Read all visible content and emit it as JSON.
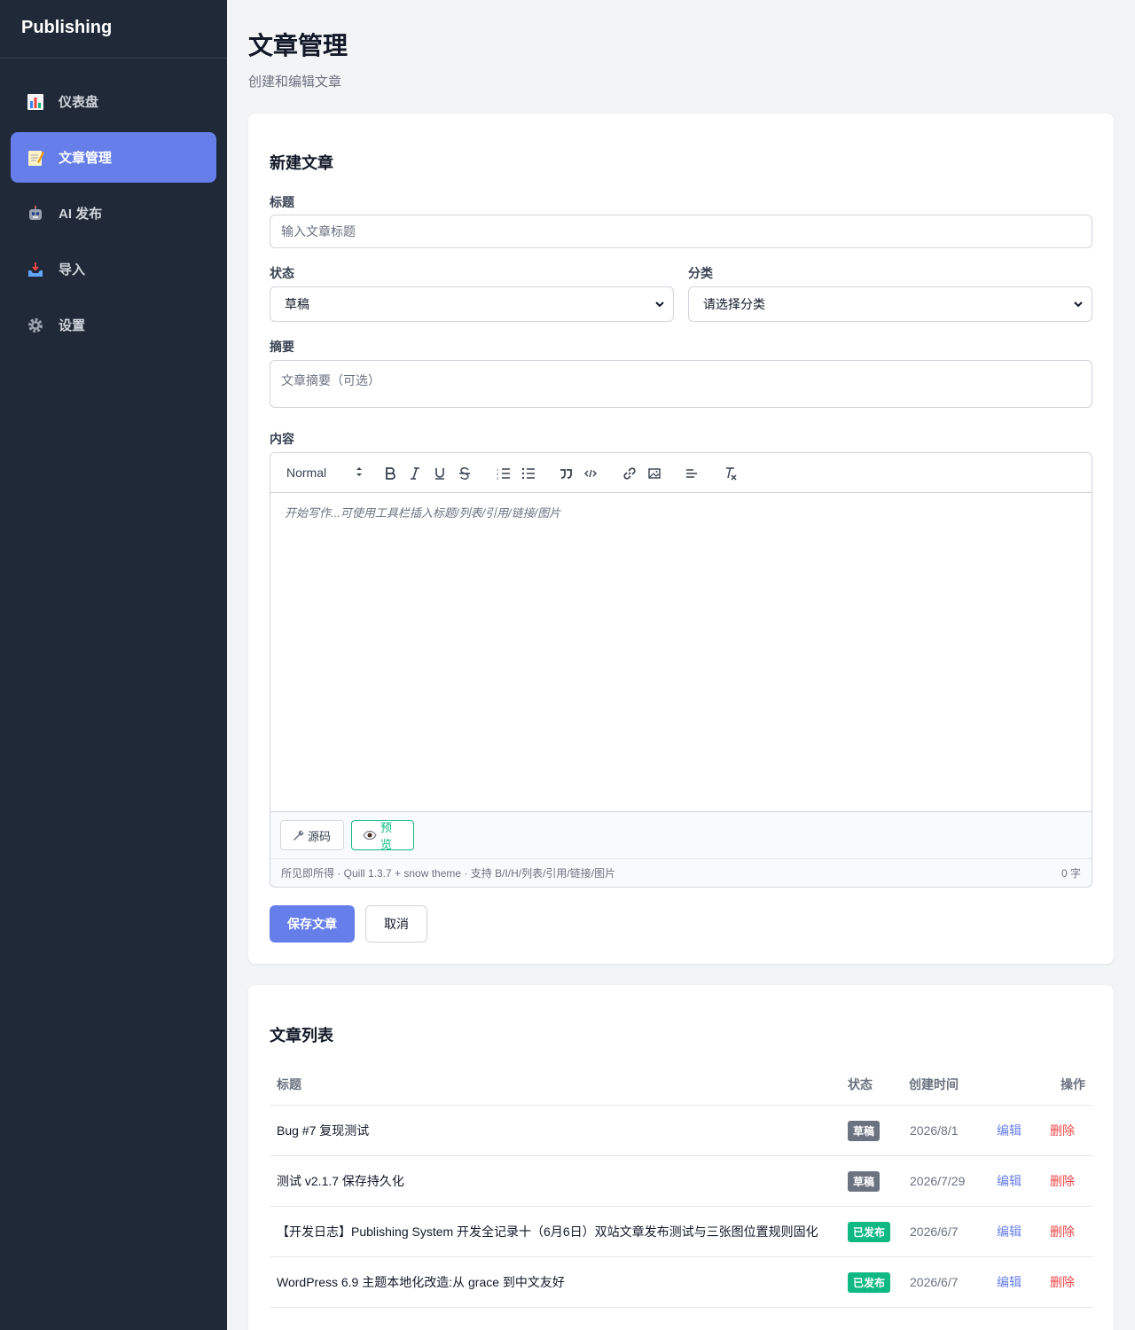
{
  "sidebar": {
    "brand": "Publishing",
    "items": [
      {
        "label": "仪表盘",
        "icon": "bar-chart-icon"
      },
      {
        "label": "文章管理",
        "icon": "memo-icon",
        "active": true
      },
      {
        "label": "AI 发布",
        "icon": "robot-icon"
      },
      {
        "label": "导入",
        "icon": "inbox-tray-icon"
      },
      {
        "label": "设置",
        "icon": "gear-icon"
      }
    ]
  },
  "header": {
    "title": "文章管理",
    "subtitle": "创建和编辑文章"
  },
  "form": {
    "title": "新建文章",
    "title_label": "标题",
    "title_placeholder": "输入文章标题",
    "status_label": "状态",
    "status_value": "草稿",
    "category_label": "分类",
    "category_value": "请选择分类",
    "summary_label": "摘要",
    "summary_placeholder": "文章摘要（可选）",
    "content_label": "内容",
    "editor": {
      "header_select": "Normal",
      "placeholder": "开始写作...可使用工具栏插入标题/列表/引用/链接/图片",
      "source_button": "源码",
      "preview_button": "预览",
      "status_info": "所见即所得 · Quill 1.3.7 + snow theme · 支持 B/I/H/列表/引用/链接/图片",
      "word_count": "0 字"
    },
    "save_button": "保存文章",
    "cancel_button": "取消"
  },
  "list": {
    "title": "文章列表",
    "columns": {
      "title": "标题",
      "status": "状态",
      "created": "创建时间",
      "actions": "操作"
    },
    "edit_label": "编辑",
    "delete_label": "删除",
    "rows": [
      {
        "title": "Bug #7 复现测试",
        "status": "草稿",
        "status_type": "draft",
        "date": "2026/8/1",
        "edit": "编辑",
        "delete": "删除"
      },
      {
        "title": "测试 v2.1.7 保存持久化",
        "status": "草稿",
        "status_type": "draft",
        "date": "2026/7/29",
        "edit": "编辑",
        "delete": "删除"
      },
      {
        "title": "【开发日志】Publishing System 开发全记录十（6月6日）双站文章发布测试与三张图位置规则固化",
        "status": "已发布",
        "status_type": "published",
        "date": "2026/6/7",
        "edit": "编辑",
        "delete": "删除"
      },
      {
        "title": "WordPress 6.9 主题本地化改造:从 grace 到中文友好",
        "status": "已发布",
        "status_type": "published",
        "date": "2026/6/7",
        "edit": "编辑",
        "delete": "删除"
      }
    ]
  },
  "colors": {
    "sidebar_bg": "#1f2937",
    "accent": "#667eea",
    "draft": "#6b7280",
    "published": "#10b981",
    "danger": "#ef4444"
  }
}
